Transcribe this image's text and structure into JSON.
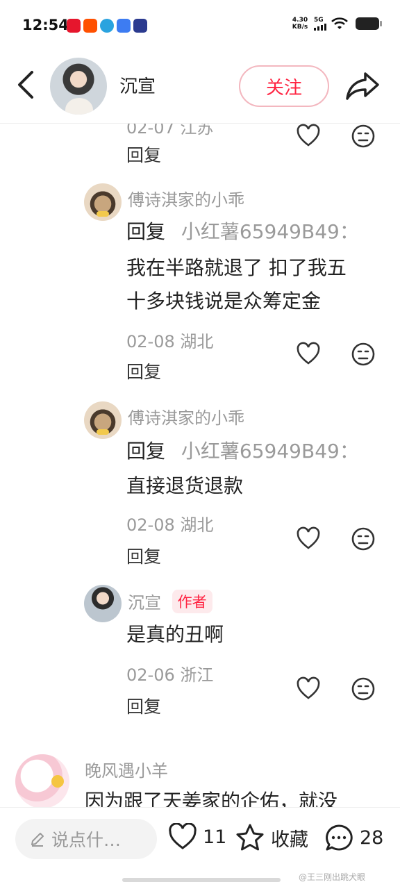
{
  "status_bar": {
    "time": "12:54",
    "net_speed_value": "4.30",
    "net_speed_unit": "KB/s",
    "network": "5G",
    "app_icons": [
      "weibo-icon",
      "taobao-icon",
      "telegram-icon",
      "app-blue-icon",
      "video-app-icon"
    ],
    "app_colors": [
      "#e6162d",
      "#ff5000",
      "#2aa3df",
      "#3d7cf2",
      "#2b3a8f"
    ]
  },
  "header": {
    "name": "沉宣",
    "follow_label": "关注"
  },
  "comments": [
    {
      "id": "c0",
      "meta": "02-07 江苏",
      "reply_label": "回复"
    },
    {
      "id": "c1",
      "name": "傅诗淇家的小乖",
      "reply_prefix": "回复",
      "reply_target": "小红薯65949B49：",
      "text_line1": "我在半路就退了 扣了我五",
      "text_line2": "十多块钱说是众筹定金",
      "meta": "02-08 湖北",
      "reply_label": "回复"
    },
    {
      "id": "c2",
      "name": "傅诗淇家的小乖",
      "reply_prefix": "回复",
      "reply_target": "小红薯65949B49：",
      "text_line1": "直接退货退款",
      "meta": "02-08 湖北",
      "reply_label": "回复"
    },
    {
      "id": "c3",
      "name": "沉宣",
      "author_tag": "作者",
      "text_line1": "是真的丑啊",
      "meta": "02-06 浙江",
      "reply_label": "回复"
    },
    {
      "id": "c4",
      "name": "晚风遇小羊",
      "text_line1": "因为跟了天姜家的企佑，就没"
    }
  ],
  "bottom_bar": {
    "input_placeholder": "说点什…",
    "like_count": "11",
    "collect_label": "收藏",
    "comment_count": "28"
  },
  "watermark": "@王三刚出跳犬眼",
  "colors": {
    "accent": "#ff2442",
    "follow_border": "#f3b7bf",
    "muted_text": "#9a9a9a"
  }
}
